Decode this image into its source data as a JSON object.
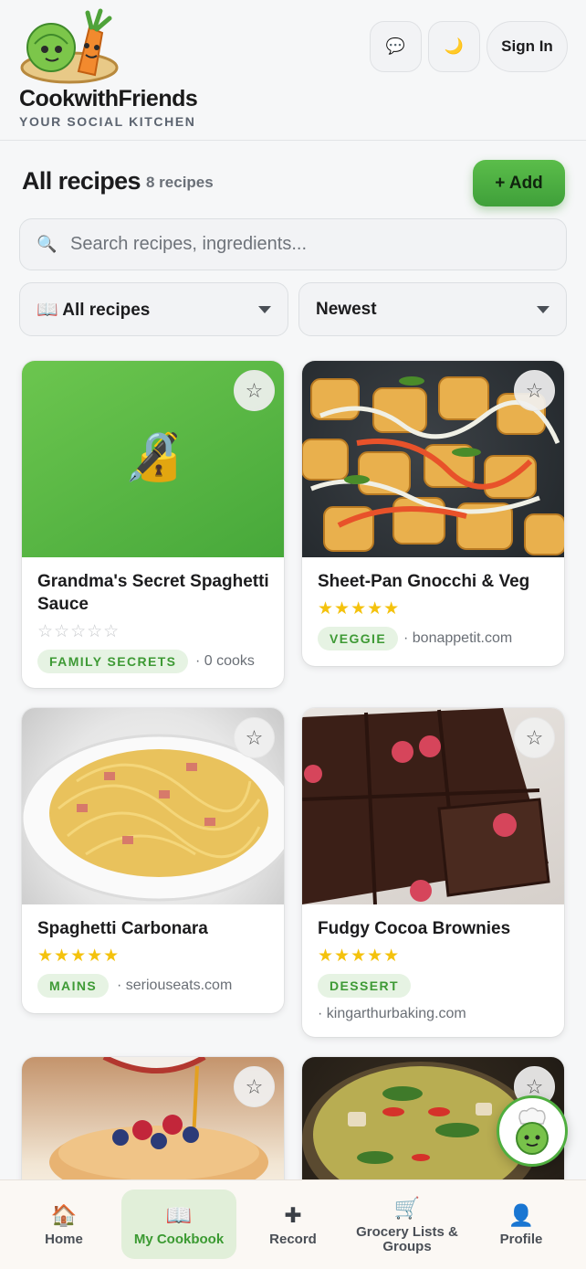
{
  "header": {
    "brand_name": "CookwithFriends",
    "tagline": "YOUR SOCIAL KITCHEN",
    "chat_icon": "💬",
    "theme_icon": "🌙",
    "sign_in": "Sign In"
  },
  "toolbar": {
    "title": "All recipes",
    "count": "8 recipes",
    "add_label": "+ Add"
  },
  "search": {
    "icon": "🔍",
    "placeholder": "Search recipes, ingredients..."
  },
  "filters": {
    "collection": "📖 All recipes",
    "sort": "Newest"
  },
  "recipes": [
    {
      "title": "Grandma's Secret Spaghetti Sauce",
      "stars": "☆☆☆☆☆",
      "rating": 0,
      "tag": "FAMILY SECRETS",
      "meta": "· 0 cooks",
      "locked_icon": "🔏",
      "favorite": "☆"
    },
    {
      "title": "Sheet-Pan Gnocchi & Veg",
      "stars": "★★★★★",
      "rating": 5,
      "tag": "VEGGIE",
      "meta": "· bonappetit.com",
      "favorite": "☆"
    },
    {
      "title": "Spaghetti Carbonara",
      "stars": "★★★★★",
      "rating": 5,
      "tag": "MAINS",
      "meta": "· seriouseats.com",
      "favorite": "☆"
    },
    {
      "title": "Fudgy Cocoa Brownies",
      "stars": "★★★★★",
      "rating": 5,
      "tag": "DESSERT",
      "meta": "· kingarthurbaking.com",
      "favorite": "☆"
    },
    {
      "favorite": "☆"
    },
    {
      "favorite": "☆"
    }
  ],
  "nav": [
    {
      "icon": "🏠",
      "label": "Home"
    },
    {
      "icon": "📖",
      "label": "My Cookbook",
      "active": true
    },
    {
      "icon": "✚",
      "label": "Record"
    },
    {
      "icon": "🛒",
      "label": "Grocery Lists & Groups"
    },
    {
      "icon": "👤",
      "label": "Profile"
    }
  ],
  "colors": {
    "accent": "#4fae3f",
    "tag_bg": "#e6f3e3",
    "tag_text": "#3e9a35",
    "star": "#f4c20d"
  }
}
